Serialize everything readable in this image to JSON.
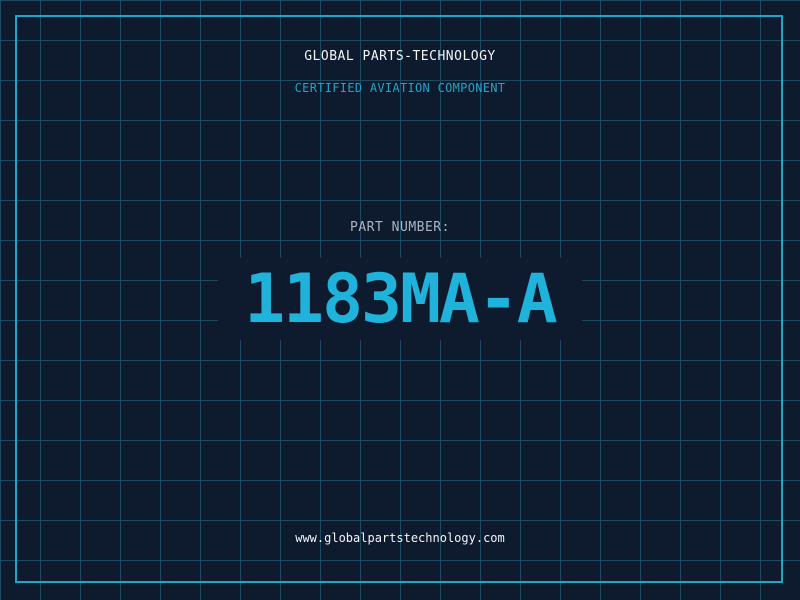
{
  "header": {
    "company": "GLOBAL PARTS-TECHNOLOGY",
    "subtitle": "CERTIFIED AVIATION COMPONENT"
  },
  "part": {
    "label": "PART NUMBER:",
    "number": "1183MA-A"
  },
  "footer": {
    "website": "www.globalpartstechnology.com"
  },
  "colors": {
    "background": "#0e1a2e",
    "grid": "#1d4a60",
    "accent": "#1ea5c8",
    "text": "#f2f5f8"
  }
}
